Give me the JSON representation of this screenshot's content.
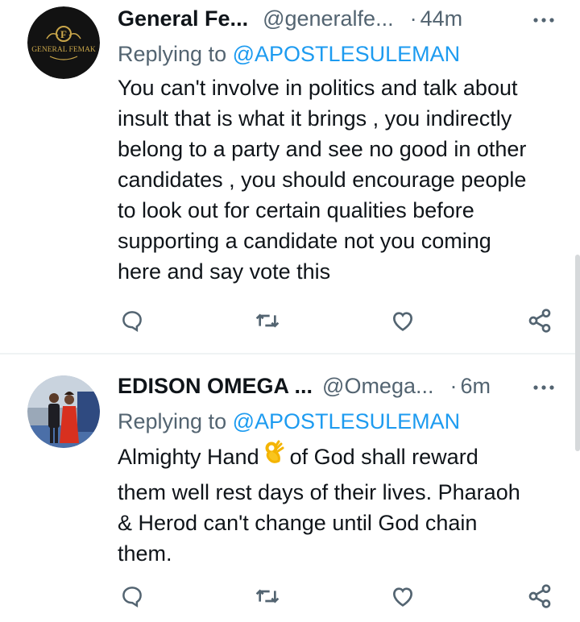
{
  "tweets": [
    {
      "display_name": "General Fe...",
      "handle": "@generalfe...",
      "separator": "·",
      "time": "44m",
      "replying_prefix": "Replying to",
      "replying_to": "@APOSTLESULEMAN",
      "body_lines": [
        "You can't involve in politics and talk about",
        "insult that is what it brings , you indirectly",
        "belong to a party and see no good in other",
        "candidates , you should encourage people",
        "to look out for certain qualities before",
        "supporting a candidate not you coming",
        "here and say vote this"
      ],
      "avatar": {
        "logo_letter": "F",
        "logo_text": "GENERAL FEMAK",
        "accent_color": "#c9a64a"
      }
    },
    {
      "display_name": "EDISON OMEGA ...",
      "handle": "@Omega...",
      "separator": "·",
      "time": "6m",
      "replying_prefix": "Replying to",
      "replying_to": "@APOSTLESULEMAN",
      "body_lines": [
        "Almighty Hand",
        "of God shall reward",
        "them well rest days of their lives. Pharaoh",
        "& Herod can't change until God chain",
        "them."
      ],
      "emoji": "ok-hand-emoji"
    }
  ],
  "icons": {
    "more": "more-horizontal-icon",
    "reply": "reply-icon",
    "retweet": "retweet-icon",
    "like": "heart-icon",
    "share": "share-icon"
  },
  "colors": {
    "text": "#0f1419",
    "secondary": "#536471",
    "link": "#1d9bf0",
    "divider": "#eff3f4"
  }
}
